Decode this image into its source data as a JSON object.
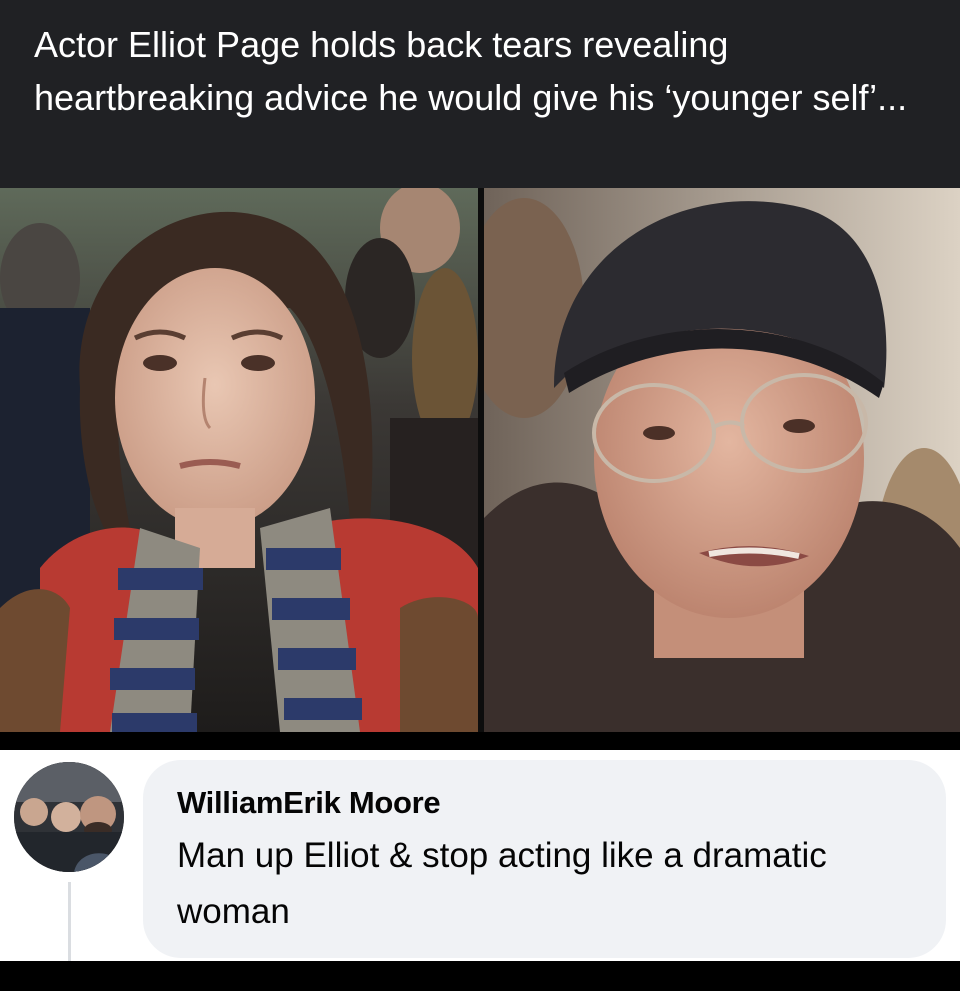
{
  "post": {
    "caption": "Actor Elliot Page holds back tears revealing heartbreaking advice he would give his ‘younger self’..."
  },
  "photos": {
    "left": {
      "icon": "portrait-photo"
    },
    "right": {
      "icon": "portrait-photo"
    }
  },
  "comment": {
    "author": "WilliamErik Moore",
    "text": "Man up Elliot & stop acting like a dramatic woman",
    "avatar_icon": "profile-photo"
  },
  "colors": {
    "caption_bg": "#202124",
    "caption_text": "#ffffff",
    "bubble_bg": "#f0f2f5",
    "comment_text": "#050505",
    "page_bg": "#000000"
  }
}
